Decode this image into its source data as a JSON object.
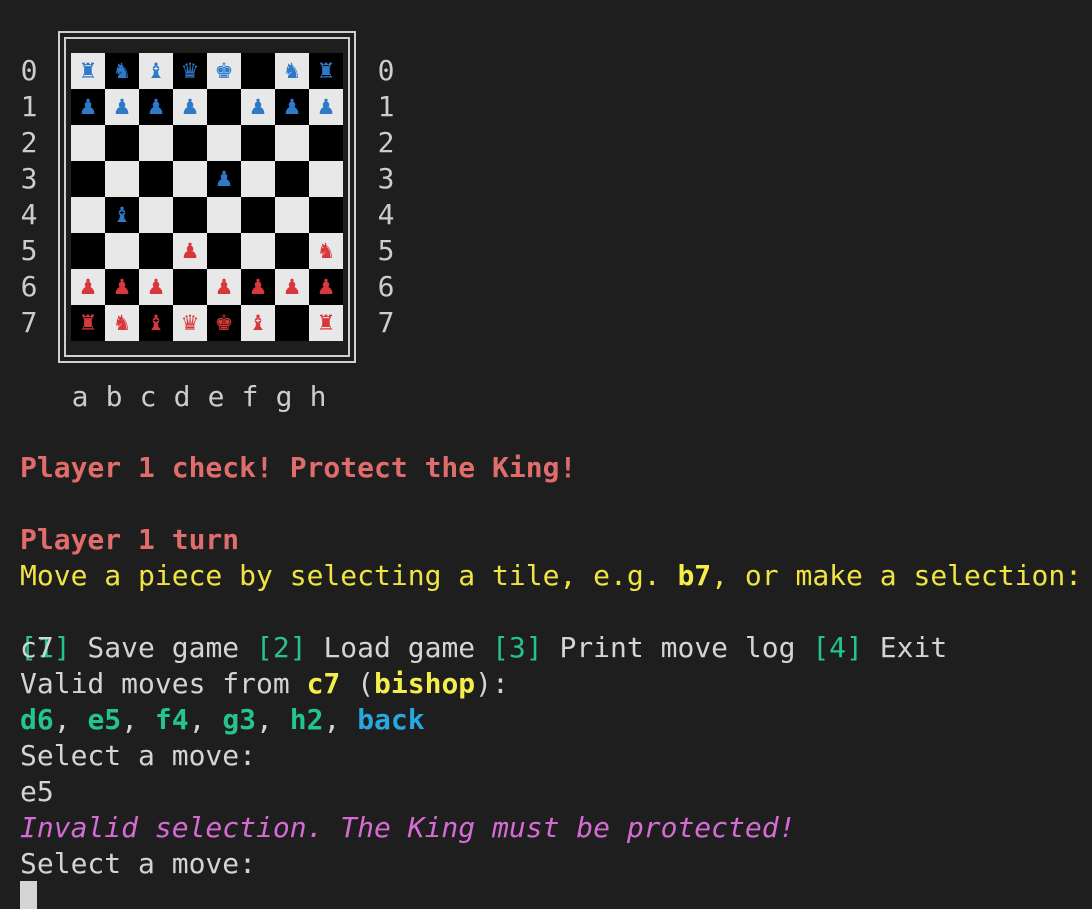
{
  "board": {
    "ranks_left": [
      "0",
      "1",
      "2",
      "3",
      "4",
      "5",
      "6",
      "7"
    ],
    "ranks_right": [
      "0",
      "1",
      "2",
      "3",
      "4",
      "5",
      "6",
      "7"
    ],
    "files": [
      "a",
      "b",
      "c",
      "d",
      "e",
      "f",
      "g",
      "h"
    ],
    "rows": [
      [
        [
          "♜",
          "blue"
        ],
        [
          "♞",
          "blue"
        ],
        [
          "♝",
          "blue"
        ],
        [
          "♛",
          "blue"
        ],
        [
          "♚",
          "blue"
        ],
        null,
        [
          "♞",
          "blue"
        ],
        [
          "♜",
          "blue"
        ]
      ],
      [
        [
          "♟",
          "blue"
        ],
        [
          "♟",
          "blue"
        ],
        [
          "♟",
          "blue"
        ],
        [
          "♟",
          "blue"
        ],
        null,
        [
          "♟",
          "blue"
        ],
        [
          "♟",
          "blue"
        ],
        [
          "♟",
          "blue"
        ]
      ],
      [
        null,
        null,
        null,
        null,
        null,
        null,
        null,
        null
      ],
      [
        null,
        null,
        null,
        null,
        [
          "♟",
          "blue"
        ],
        null,
        null,
        null
      ],
      [
        null,
        [
          "♝",
          "blue"
        ],
        null,
        null,
        null,
        null,
        null,
        null
      ],
      [
        null,
        null,
        null,
        [
          "♟",
          "red"
        ],
        null,
        null,
        null,
        [
          "♞",
          "red"
        ]
      ],
      [
        [
          "♟",
          "red"
        ],
        [
          "♟",
          "red"
        ],
        [
          "♟",
          "red"
        ],
        null,
        [
          "♟",
          "red"
        ],
        [
          "♟",
          "red"
        ],
        [
          "♟",
          "red"
        ],
        [
          "♟",
          "red"
        ]
      ],
      [
        [
          "♜",
          "red"
        ],
        [
          "♞",
          "red"
        ],
        [
          "♝",
          "red"
        ],
        [
          "♛",
          "red"
        ],
        [
          "♚",
          "red"
        ],
        [
          "♝",
          "red"
        ],
        null,
        [
          "♜",
          "red"
        ]
      ]
    ]
  },
  "console": {
    "check_message": "Player 1 check! Protect the King!",
    "turn": "Player 1 turn",
    "instruction_pre": "Move a piece by selecting a tile, e.g. ",
    "instruction_example": "b7",
    "instruction_post": ", or make a selection:",
    "menu": [
      {
        "key": "[1]",
        "label": " Save game "
      },
      {
        "key": "[2]",
        "label": " Load game "
      },
      {
        "key": "[3]",
        "label": " Print move log "
      },
      {
        "key": "[4]",
        "label": " Exit"
      }
    ],
    "input_tile": "c7",
    "valid_moves_pre": "Valid moves from ",
    "valid_moves_tile": "c7",
    "valid_moves_open": " (",
    "valid_moves_piece": "bishop",
    "valid_moves_close": "):",
    "moves": [
      "d6",
      "e5",
      "f4",
      "g3",
      "h2"
    ],
    "move_separator": ", ",
    "back_label": "back",
    "select_prompt_1": "Select a move:",
    "input_move": "e5",
    "error_message": "Invalid selection. The King must be protected!",
    "select_prompt_2": "Select a move:"
  }
}
